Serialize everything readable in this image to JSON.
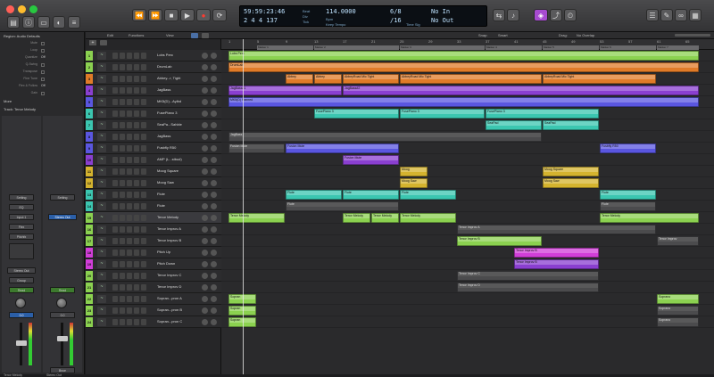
{
  "window": {
    "title": "",
    "colors": {
      "close": "#ff5f57",
      "minimize": "#febc2e",
      "zoom": "#28c840",
      "accent": "#a74bd1"
    }
  },
  "transport": {
    "position_time": "59:59:23:46",
    "position_bars": "2 4 4 137",
    "tempo": "114.0000",
    "signature": "6/8",
    "signature_sub": "/16",
    "key": "No In",
    "key_sub": "No Out",
    "keep_tempo": "Keep Tempo",
    "sub_labels": [
      "Beat",
      "Div",
      "Tick",
      "Bpm",
      "Time Sig"
    ]
  },
  "toolbar2": {
    "edit": "Edit",
    "functions": "Functions",
    "view": "View",
    "snap_label": "Snap:",
    "snap_value": "Smart",
    "drag_label": "Drag:",
    "drag_value": "No Overlap"
  },
  "inspector": {
    "region_header": "Region: Audio Defaults",
    "rows": [
      {
        "label": "Mute",
        "value": ""
      },
      {
        "label": "Loop",
        "value": ""
      },
      {
        "label": "Quantize",
        "value": "Off"
      },
      {
        "label": "Q-Swing",
        "value": ""
      },
      {
        "label": "Transpose",
        "value": ""
      },
      {
        "label": "Fine Tune",
        "value": ""
      },
      {
        "label": "Flex & Follow",
        "value": "Off"
      },
      {
        "label": "Gain",
        "value": ""
      }
    ],
    "more": "More",
    "track_header": "Track: Tenor Melody",
    "strip_left": {
      "input": "Input 1",
      "output": "Stereo Out",
      "group": "Group",
      "read": "Read",
      "eq": "EQ",
      "name": "Tenor Melody",
      "insert": "Flex",
      "setting": "Setting",
      "fx": "Pitchfx"
    },
    "strip_right": {
      "output": "Stereo Out",
      "read": "Read",
      "name": "Stereo Out",
      "setting": "Setting",
      "bnce": "Bnce"
    }
  },
  "tracks": [
    {
      "num": "1",
      "name": "Lobs Perc",
      "color": "#8bd150",
      "icon": "~"
    },
    {
      "num": "2",
      "name": "DrumLab",
      "color": "#8bd150",
      "icon": "~"
    },
    {
      "num": "3",
      "name": "Abbey...r, Tight",
      "color": "#e07b28",
      "icon": "~"
    },
    {
      "num": "4",
      "name": "JagBass",
      "color": "#8a3fd0",
      "icon": "~"
    },
    {
      "num": "5",
      "name": "MK5(D)...Aylbd",
      "color": "#5a56e0",
      "icon": "~"
    },
    {
      "num": "6",
      "name": "FusePiano 3",
      "color": "#3bc6b0",
      "icon": "~"
    },
    {
      "num": "7",
      "name": "SeaPa...Sahble",
      "color": "#3bc6b0",
      "icon": "~"
    },
    {
      "num": "8",
      "name": "JagBass",
      "color": "#5a56e0",
      "icon": "~"
    },
    {
      "num": "9",
      "name": "Fusbfly R50",
      "color": "#5a56e0",
      "icon": "~"
    },
    {
      "num": "10",
      "name": "AMP (L...stbud)",
      "color": "#8a3fd0",
      "icon": "~"
    },
    {
      "num": "11",
      "name": "Moog Square",
      "color": "#d4b32e",
      "icon": "~"
    },
    {
      "num": "12",
      "name": "Moog Saw",
      "color": "#d4b32e",
      "icon": "~"
    },
    {
      "num": "13",
      "name": "Flute",
      "color": "#3bc6b0",
      "icon": "~"
    },
    {
      "num": "14",
      "name": "Flute",
      "color": "#3bc6b0",
      "icon": "~"
    },
    {
      "num": "15",
      "name": "Tenor Melody",
      "color": "#8bd150",
      "icon": "~"
    },
    {
      "num": "16",
      "name": "Tenor Improv A",
      "color": "#8bd150",
      "icon": "~"
    },
    {
      "num": "17",
      "name": "Tenor Improv B",
      "color": "#8bd150",
      "icon": "~"
    },
    {
      "num": "18",
      "name": "Pitch Up",
      "color": "#d13ed8",
      "icon": "~"
    },
    {
      "num": "19",
      "name": "Pitch Down",
      "color": "#d13ed8",
      "icon": "~"
    },
    {
      "num": "20",
      "name": "Tenor Improv C",
      "color": "#8bd150",
      "icon": "~"
    },
    {
      "num": "21",
      "name": "Tenor Improv D",
      "color": "#8bd150",
      "icon": "~"
    },
    {
      "num": "22",
      "name": "Sopran...pron A",
      "color": "#8bd150",
      "icon": "~"
    },
    {
      "num": "23",
      "name": "Sopran...pron B",
      "color": "#8bd150",
      "icon": "~"
    },
    {
      "num": "24",
      "name": "Sopran...pron C",
      "color": "#8bd150",
      "icon": "~"
    }
  ],
  "ruler": {
    "ticks": [
      {
        "label": "1",
        "bar": 1
      },
      {
        "label": "5",
        "bar": 5
      },
      {
        "label": "9",
        "bar": 9
      },
      {
        "label": "13",
        "bar": 13
      },
      {
        "label": "17",
        "bar": 17
      },
      {
        "label": "21",
        "bar": 21
      },
      {
        "label": "25",
        "bar": 25
      },
      {
        "label": "29",
        "bar": 29
      },
      {
        "label": "33",
        "bar": 33
      },
      {
        "label": "37",
        "bar": 37
      },
      {
        "label": "41",
        "bar": 41
      },
      {
        "label": "45",
        "bar": 45
      },
      {
        "label": "49",
        "bar": 49
      },
      {
        "label": "53",
        "bar": 53
      },
      {
        "label": "57",
        "bar": 57
      },
      {
        "label": "61",
        "bar": 61
      },
      {
        "label": "65",
        "bar": 65
      }
    ],
    "markers": [
      {
        "label": "Marker 1",
        "bar": 5,
        "end": 13
      },
      {
        "label": "Marker 2",
        "bar": 13,
        "end": 25
      },
      {
        "label": "Marker 3",
        "bar": 25,
        "end": 37
      },
      {
        "label": "Marker 4",
        "bar": 37,
        "end": 45
      },
      {
        "label": "Marker 5",
        "bar": 45,
        "end": 53
      },
      {
        "label": "Marker 6",
        "bar": 53,
        "end": 61
      },
      {
        "label": "Marker 7",
        "bar": 61,
        "end": 67
      }
    ]
  },
  "regions": [
    {
      "track": 0,
      "start": 1,
      "end": 67,
      "name": "Lobs Perc",
      "color": "#8bd150"
    },
    {
      "track": 1,
      "start": 1,
      "end": 67,
      "name": "DrumLab",
      "color": "#e07b28"
    },
    {
      "track": 2,
      "start": 9,
      "end": 13,
      "name": "Abbey",
      "color": "#e07b28"
    },
    {
      "track": 2,
      "start": 13,
      "end": 17,
      "name": "Abbey",
      "color": "#e07b28"
    },
    {
      "track": 2,
      "start": 17,
      "end": 25,
      "name": "AbbeyRoad Mic Tight",
      "color": "#e07b28"
    },
    {
      "track": 2,
      "start": 25,
      "end": 45,
      "name": "AbbeyRoad Mic Tight",
      "color": "#e07b28"
    },
    {
      "track": 2,
      "start": 45,
      "end": 61,
      "name": "AbbeyRoad Mic Tight",
      "color": "#e07b28"
    },
    {
      "track": 3,
      "start": 1,
      "end": 17,
      "name": "JagBass#1",
      "color": "#8a3fd0"
    },
    {
      "track": 3,
      "start": 17,
      "end": 67,
      "name": "JagBass#2",
      "color": "#8a3fd0"
    },
    {
      "track": 4,
      "start": 1,
      "end": 67,
      "name": "MK5(D) Panned",
      "color": "#5a56e0"
    },
    {
      "track": 5,
      "start": 13,
      "end": 25,
      "name": "FusePiano 3",
      "color": "#3bc6b0"
    },
    {
      "track": 5,
      "start": 25,
      "end": 37,
      "name": "FusePiano 3",
      "color": "#3bc6b0"
    },
    {
      "track": 5,
      "start": 37,
      "end": 53,
      "name": "FusePiano 3",
      "color": "#3bc6b0"
    },
    {
      "track": 6,
      "start": 37,
      "end": 45,
      "name": "SeaPad",
      "color": "#3bc6b0"
    },
    {
      "track": 6,
      "start": 45,
      "end": 53,
      "name": "SeaPad",
      "color": "#3bc6b0"
    },
    {
      "track": 7,
      "start": 1,
      "end": 45,
      "name": "JagBass",
      "color": "grey"
    },
    {
      "track": 8,
      "start": 1,
      "end": 9,
      "name": "Fusion Mute",
      "color": "grey"
    },
    {
      "track": 8,
      "start": 9,
      "end": 25,
      "name": "Fusion Mute",
      "color": "#5a56e0"
    },
    {
      "track": 8,
      "start": 53,
      "end": 61,
      "name": "Fusbfly R50",
      "color": "#5a56e0"
    },
    {
      "track": 9,
      "start": 17,
      "end": 25,
      "name": "Fusion Mute",
      "color": "#8a3fd0"
    },
    {
      "track": 10,
      "start": 25,
      "end": 29,
      "name": "Moog",
      "color": "#d4b32e"
    },
    {
      "track": 10,
      "start": 45,
      "end": 53,
      "name": "Moog Square",
      "color": "#d4b32e"
    },
    {
      "track": 11,
      "start": 25,
      "end": 29,
      "name": "Moog Saw",
      "color": "#d4b32e"
    },
    {
      "track": 11,
      "start": 45,
      "end": 53,
      "name": "Moog Saw",
      "color": "#d4b32e"
    },
    {
      "track": 12,
      "start": 9,
      "end": 17,
      "name": "Flute",
      "color": "#3bc6b0"
    },
    {
      "track": 12,
      "start": 17,
      "end": 25,
      "name": "Flute",
      "color": "#3bc6b0"
    },
    {
      "track": 12,
      "start": 25,
      "end": 33,
      "name": "Flute",
      "color": "#3bc6b0"
    },
    {
      "track": 12,
      "start": 53,
      "end": 61,
      "name": "Flute",
      "color": "#3bc6b0"
    },
    {
      "track": 13,
      "start": 9,
      "end": 25,
      "name": "Flute",
      "color": "grey"
    },
    {
      "track": 13,
      "start": 53,
      "end": 61,
      "name": "Flute",
      "color": "grey"
    },
    {
      "track": 14,
      "start": 1,
      "end": 9,
      "name": "Tenor Melody",
      "color": "#8bd150"
    },
    {
      "track": 14,
      "start": 17,
      "end": 21,
      "name": "Tenor Melody",
      "color": "#8bd150"
    },
    {
      "track": 14,
      "start": 21,
      "end": 25,
      "name": "Tenor Melody",
      "color": "#8bd150"
    },
    {
      "track": 14,
      "start": 25,
      "end": 33,
      "name": "Tenor Melody",
      "color": "#8bd150"
    },
    {
      "track": 14,
      "start": 53,
      "end": 67,
      "name": "Tenor Melody",
      "color": "#8bd150"
    },
    {
      "track": 15,
      "start": 33,
      "end": 61,
      "name": "Tenor Improv A",
      "color": "grey"
    },
    {
      "track": 16,
      "start": 33,
      "end": 45,
      "name": "Tenor Improv B",
      "color": "#8bd150"
    },
    {
      "track": 16,
      "start": 61,
      "end": 67,
      "name": "Tenor Improv",
      "color": "grey"
    },
    {
      "track": 17,
      "start": 41,
      "end": 53,
      "name": "Tenor Improv B",
      "color": "#d13ed8"
    },
    {
      "track": 18,
      "start": 41,
      "end": 53,
      "name": "Tenor Improv B",
      "color": "#8a3fd0"
    },
    {
      "track": 19,
      "start": 33,
      "end": 53,
      "name": "Tenor Improv C",
      "color": "grey"
    },
    {
      "track": 20,
      "start": 33,
      "end": 53,
      "name": "Tenor Improv D",
      "color": "grey"
    },
    {
      "track": 21,
      "start": 1,
      "end": 5,
      "name": "Sopran",
      "color": "#8bd150"
    },
    {
      "track": 21,
      "start": 61,
      "end": 67,
      "name": "Soprano",
      "color": "#8bd150"
    },
    {
      "track": 22,
      "start": 1,
      "end": 5,
      "name": "Sopran",
      "color": "#8bd150"
    },
    {
      "track": 22,
      "start": 61,
      "end": 67,
      "name": "Soprano",
      "color": "grey"
    },
    {
      "track": 23,
      "start": 1,
      "end": 5,
      "name": "Sopran",
      "color": "#8bd150"
    },
    {
      "track": 23,
      "start": 61,
      "end": 67,
      "name": "Soprano",
      "color": "grey"
    }
  ]
}
